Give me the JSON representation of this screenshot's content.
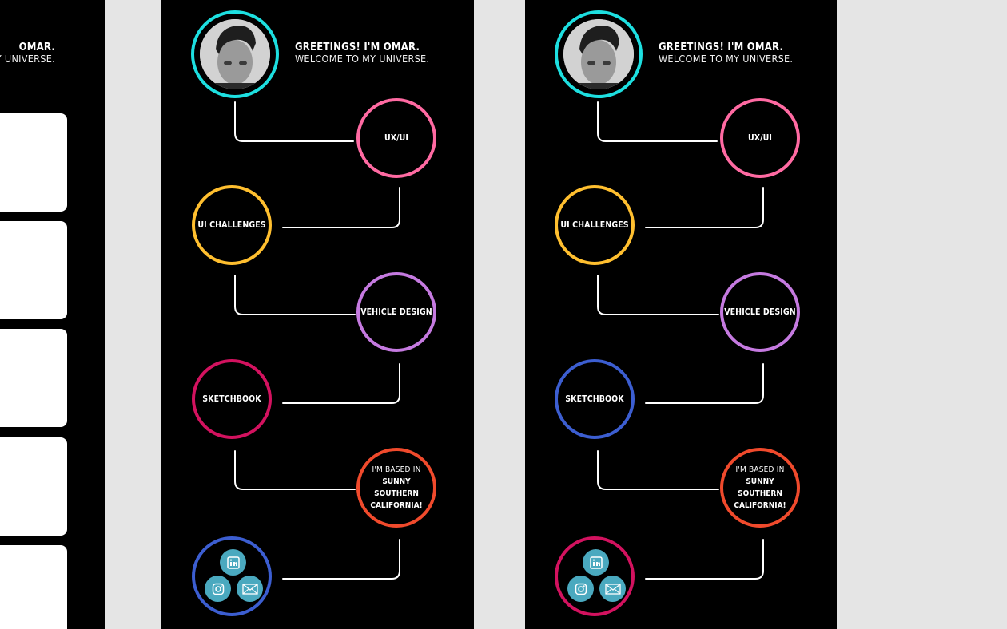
{
  "greeting": {
    "line1": "GREETINGS! I'M OMAR.",
    "line2": "WELCOME TO MY UNIVERSE."
  },
  "left_partial": {
    "line1": "OMAR.",
    "line2": "Y UNIVERSE."
  },
  "nodes": {
    "uxui": "UX/UI",
    "ui_challenges": "UI CHALLENGES",
    "vehicle_design": "VEHICLE DESIGN",
    "sketchbook": "SKETCHBOOK",
    "based_intro": "I'M BASED IN",
    "based_l1": "SUNNY",
    "based_l2": "SOUTHERN",
    "based_l3": "CALIFORNIA!"
  },
  "social": [
    "linkedin-icon",
    "instagram-icon",
    "mail-icon"
  ],
  "colors": {
    "background": "#000000",
    "canvas": "#e5e5e5",
    "avatar_ring": "#1ddfe0",
    "uxui": "#ff6aa2",
    "ui_challenges": "#ffbf2f",
    "vehicle_design": "#c57ae0",
    "sketchbook_a": "#d3125f",
    "sketchbook_b": "#3c5ed1",
    "california": "#f04a2c",
    "social_a": "#3c5ed1",
    "social_b": "#d3125f",
    "social_button": "#4aa9bf"
  }
}
